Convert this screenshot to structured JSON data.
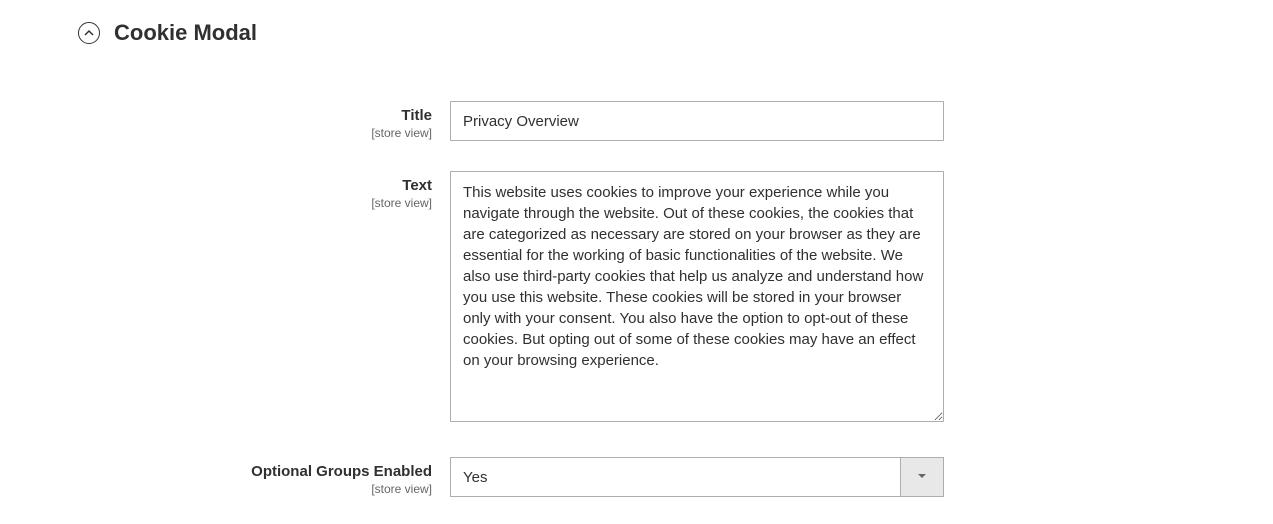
{
  "section": {
    "title": "Cookie Modal"
  },
  "fields": {
    "title": {
      "label": "Title",
      "scope": "[store view]",
      "value": "Privacy Overview"
    },
    "text": {
      "label": "Text",
      "scope": "[store view]",
      "value": "This website uses cookies to improve your experience while you navigate through the website. Out of these cookies, the cookies that are categorized as necessary are stored on your browser as they are essential for the working of basic functionalities of the website. We also use third-party cookies that help us analyze and understand how you use this website. These cookies will be stored in your browser only with your consent. You also have the option to opt-out of these cookies. But opting out of some of these cookies may have an effect on your browsing experience."
    },
    "optional_groups": {
      "label": "Optional Groups Enabled",
      "scope": "[store view]",
      "value": "Yes"
    }
  }
}
